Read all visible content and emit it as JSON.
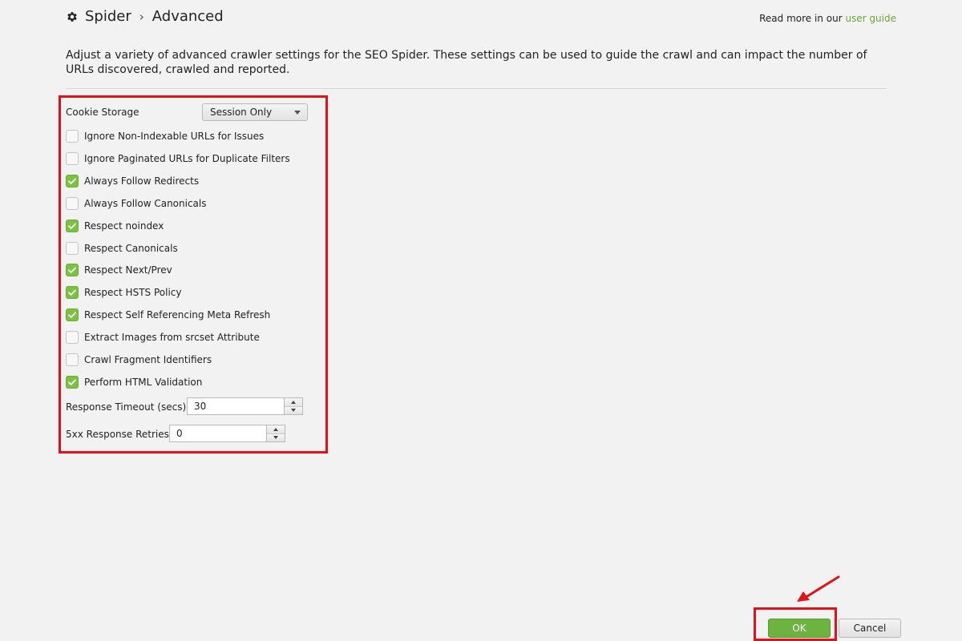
{
  "header": {
    "breadcrumb_root": "Spider",
    "breadcrumb_separator": "›",
    "breadcrumb_current": "Advanced",
    "read_more_prefix": "Read more in our",
    "read_more_link": "user guide"
  },
  "description": "Adjust a variety of advanced crawler settings for the SEO Spider. These settings can be used to guide the crawl and can impact the number of URLs discovered, crawled and reported.",
  "cookie_storage": {
    "label": "Cookie Storage",
    "value": "Session Only"
  },
  "checkboxes": [
    {
      "label": "Ignore Non-Indexable URLs for Issues",
      "checked": false
    },
    {
      "label": "Ignore Paginated URLs for Duplicate Filters",
      "checked": false
    },
    {
      "label": "Always Follow Redirects",
      "checked": true
    },
    {
      "label": "Always Follow Canonicals",
      "checked": false
    },
    {
      "label": "Respect noindex",
      "checked": true
    },
    {
      "label": "Respect Canonicals",
      "checked": false
    },
    {
      "label": "Respect Next/Prev",
      "checked": true
    },
    {
      "label": "Respect HSTS Policy",
      "checked": true
    },
    {
      "label": "Respect Self Referencing Meta Refresh",
      "checked": true
    },
    {
      "label": "Extract Images from srcset Attribute",
      "checked": false
    },
    {
      "label": "Crawl Fragment Identifiers",
      "checked": false
    },
    {
      "label": "Perform HTML Validation",
      "checked": true
    }
  ],
  "response_timeout": {
    "label": "Response Timeout (secs)",
    "value": "30"
  },
  "response_retries": {
    "label": "5xx Response Retries",
    "value": "0"
  },
  "buttons": {
    "ok": "OK",
    "cancel": "Cancel"
  },
  "colors": {
    "accent_green": "#6cb33f",
    "highlight_red": "#e0131b",
    "link_green": "#6aa832"
  }
}
